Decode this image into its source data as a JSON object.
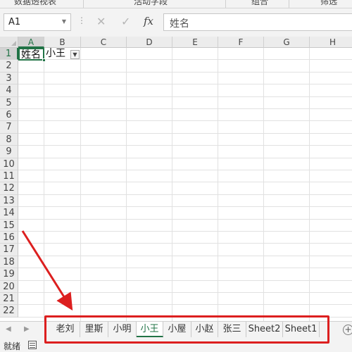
{
  "ribbon": {
    "group_labels": [
      "数据透视表",
      "活动字段",
      "组合",
      "筛选"
    ]
  },
  "formula_bar": {
    "name_box": "A1",
    "cancel_symbol": "✕",
    "enter_symbol": "✓",
    "fx_label": "fx",
    "content": "姓名"
  },
  "grid": {
    "columns": [
      "A",
      "B",
      "C",
      "D",
      "E",
      "F",
      "G",
      "H"
    ],
    "rows": [
      "1",
      "2",
      "3",
      "4",
      "5",
      "6",
      "7",
      "8",
      "9",
      "10",
      "11",
      "12",
      "13",
      "14",
      "15",
      "16",
      "17",
      "18",
      "19",
      "20",
      "21",
      "22"
    ],
    "selected_cell": "A1",
    "cells": {
      "A1": "姓名",
      "B1": "小王"
    },
    "filter_icon": "filter-dropdown-icon"
  },
  "sheet_tabs": {
    "tabs": [
      "老刘",
      "里斯",
      "小明",
      "小王",
      "小屋",
      "小赵",
      "张三",
      "Sheet2",
      "Sheet1"
    ],
    "active": "小王",
    "add_symbol": "+"
  },
  "status_bar": {
    "text": "就绪"
  },
  "annotation": {
    "color": "#dc1f1f"
  },
  "colors": {
    "accent": "#217346",
    "annotation": "#dc1f1f"
  }
}
